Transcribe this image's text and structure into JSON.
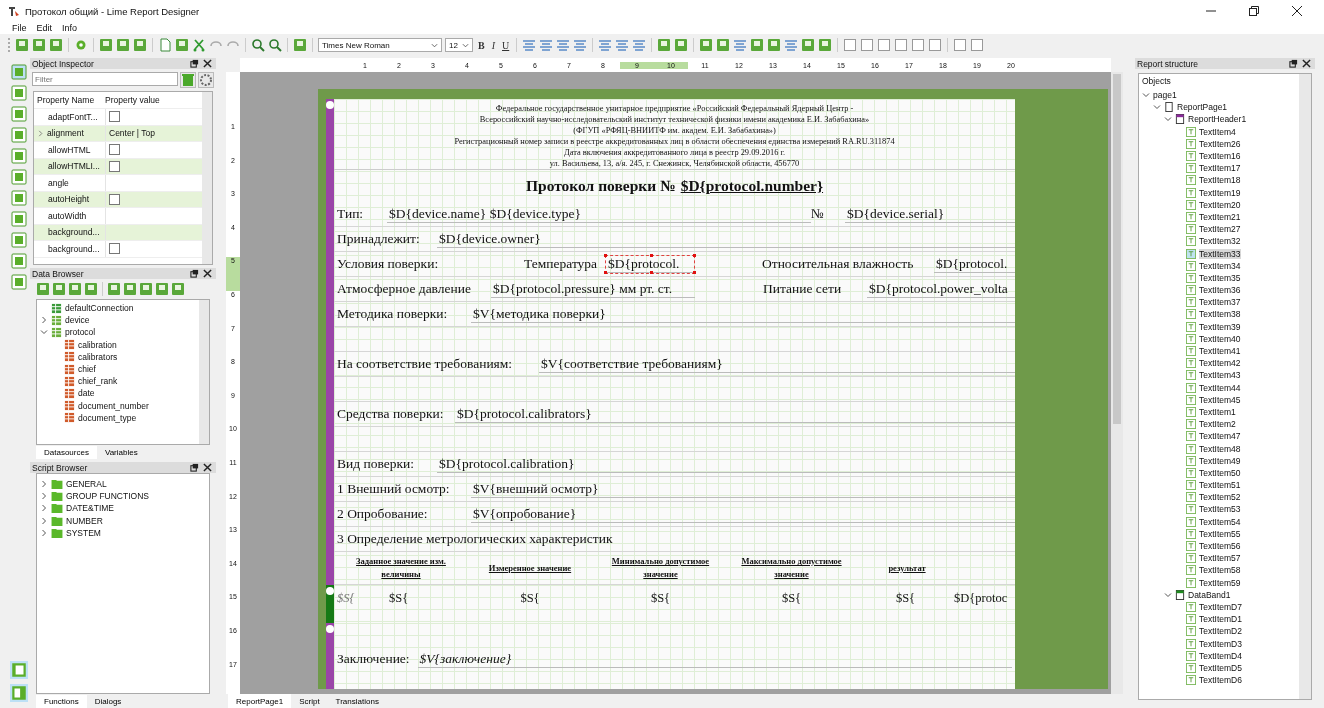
{
  "window": {
    "title": "Протокол общий - Lime Report Designer"
  },
  "menu": [
    "File",
    "Edit",
    "Info"
  ],
  "toolbar": {
    "font": "Times New Roman",
    "size": "12",
    "format": [
      {
        "label": "B",
        "kind": "bold"
      },
      {
        "label": "I",
        "kind": "italic"
      },
      {
        "label": "U",
        "kind": "underline"
      }
    ]
  },
  "object_inspector": {
    "title": "Object Inspector",
    "filter_placeholder": "Filter",
    "columns": [
      "Property Name",
      "Property value"
    ],
    "rows": [
      {
        "name": "adaptFontT...",
        "kind": "checkbox",
        "checked": false,
        "expandable": false
      },
      {
        "name": "alignment",
        "kind": "text",
        "value": "Center | Top",
        "expandable": true
      },
      {
        "name": "allowHTML",
        "kind": "checkbox",
        "checked": false,
        "expandable": false
      },
      {
        "name": "allowHTMLI...",
        "kind": "checkbox",
        "checked": false,
        "expandable": false
      },
      {
        "name": "angle",
        "kind": "text",
        "expandable": false
      },
      {
        "name": "autoHeight",
        "kind": "checkbox",
        "checked": false,
        "expandable": false
      },
      {
        "name": "autoWidth",
        "kind": "text",
        "expandable": false
      },
      {
        "name": "background...",
        "kind": "text",
        "expandable": false
      },
      {
        "name": "background...",
        "kind": "checkbox",
        "checked": false,
        "expandable": false
      }
    ]
  },
  "data_browser": {
    "title": "Data Browser",
    "tree": [
      {
        "label": "defaultConnection",
        "kind": "connection"
      },
      {
        "label": "device",
        "kind": "table",
        "expanded": false
      },
      {
        "label": "protocol",
        "kind": "table",
        "expanded": true,
        "children": [
          {
            "label": "calibration",
            "kind": "field"
          },
          {
            "label": "calibrators",
            "kind": "field"
          },
          {
            "label": "chief",
            "kind": "field"
          },
          {
            "label": "chief_rank",
            "kind": "field"
          },
          {
            "label": "date",
            "kind": "field"
          },
          {
            "label": "document_number",
            "kind": "field"
          },
          {
            "label": "document_type",
            "kind": "field"
          }
        ]
      }
    ],
    "tabs": [
      {
        "label": "Datasources",
        "selected": true
      },
      {
        "label": "Variables",
        "selected": false
      }
    ]
  },
  "script_browser": {
    "title": "Script Browser",
    "items": [
      "GENERAL",
      "GROUP FUNCTIONS",
      "DATE&TIME",
      "NUMBER",
      "SYSTEM"
    ],
    "tabs": [
      {
        "label": "Functions",
        "selected": true
      },
      {
        "label": "Dialogs",
        "selected": false
      }
    ]
  },
  "rulers": {
    "horizontal": [
      {
        "label": "1",
        "highlighted": false
      },
      {
        "label": "2",
        "highlighted": false
      },
      {
        "label": "3",
        "highlighted": false
      },
      {
        "label": "4",
        "highlighted": false
      },
      {
        "label": "5",
        "highlighted": false
      },
      {
        "label": "6",
        "highlighted": false
      },
      {
        "label": "7",
        "highlighted": false
      },
      {
        "label": "8",
        "highlighted": false
      },
      {
        "label": "9",
        "highlighted": true
      },
      {
        "label": "10",
        "highlighted": true
      },
      {
        "label": "11",
        "highlighted": false
      },
      {
        "label": "12",
        "highlighted": false
      },
      {
        "label": "13",
        "highlighted": false
      },
      {
        "label": "14",
        "highlighted": false
      },
      {
        "label": "15",
        "highlighted": false
      },
      {
        "label": "16",
        "highlighted": false
      },
      {
        "label": "17",
        "highlighted": false
      },
      {
        "label": "18",
        "highlighted": false
      },
      {
        "label": "19",
        "highlighted": false
      },
      {
        "label": "20",
        "highlighted": false
      }
    ],
    "vertical": [
      {
        "label": "1",
        "highlighted": false
      },
      {
        "label": "2",
        "highlighted": false
      },
      {
        "label": "3",
        "highlighted": false
      },
      {
        "label": "4",
        "highlighted": false
      },
      {
        "label": "5",
        "highlighted": true
      },
      {
        "label": "6",
        "highlighted": false
      },
      {
        "label": "7",
        "highlighted": false
      },
      {
        "label": "8",
        "highlighted": false
      },
      {
        "label": "9",
        "highlighted": false
      },
      {
        "label": "10",
        "highlighted": false
      },
      {
        "label": "11",
        "highlighted": false
      },
      {
        "label": "12",
        "highlighted": false
      },
      {
        "label": "13",
        "highlighted": false
      },
      {
        "label": "14",
        "highlighted": false
      },
      {
        "label": "15",
        "highlighted": false
      },
      {
        "label": "16",
        "highlighted": false
      },
      {
        "label": "17",
        "highlighted": false
      }
    ]
  },
  "report": {
    "org_lines": [
      "Федеральное государственное унитарное предприятие «Российский Федеральный Ядерный Центр -",
      "Всероссийский научно-исследовательский институт технической физики имени академика Е.И. Забабахина»",
      "(ФГУП «РФЯЦ-ВНИИТФ им. академ. Е.И. Забабахина»)",
      "Регистрационный номер записи в реестре аккредитованных лиц в области обеспечения единства измерений RA.RU.311874",
      "Дата включения аккредитованного лица в реестр 29.09.2016 г.",
      "ул. Васильева, 13, а/я. 245, г. Снежинск, Челябинской области, 456770"
    ],
    "title": "Протокол поверки №",
    "title_field": "$D{protocol.number}",
    "rows": [
      {
        "kind": "fields",
        "cells": [
          {
            "text": "Тип:",
            "kind": "label"
          },
          {
            "text": "$D{device.name} $D{device.type}",
            "kind": "field"
          },
          {
            "text": "№",
            "kind": "label"
          },
          {
            "text": "$D{device.serial}",
            "kind": "field"
          }
        ]
      },
      {
        "kind": "fields",
        "cells": [
          {
            "text": "Принадлежит:",
            "kind": "label"
          },
          {
            "text": "$D{device.owner}",
            "kind": "field"
          }
        ]
      },
      {
        "kind": "fields",
        "cells": [
          {
            "text": "Условия поверки:",
            "kind": "label"
          },
          {
            "text": "Температура",
            "kind": "label"
          },
          {
            "text": "$D{protocol.",
            "kind": "field",
            "selected": true
          },
          {
            "text": "Относительная влажность",
            "kind": "label"
          },
          {
            "text": "$D{protocol.",
            "kind": "field"
          }
        ]
      },
      {
        "kind": "fields",
        "cells": [
          {
            "text": "Атмосферное давление",
            "kind": "label"
          },
          {
            "text": "$D{protocol.pressure} мм рт. ст.",
            "kind": "field"
          },
          {
            "text": "Питание сети",
            "kind": "label"
          },
          {
            "text": "$D{protocol.power_volta",
            "kind": "field"
          }
        ]
      },
      {
        "kind": "fields",
        "cells": [
          {
            "text": "Методика поверки:",
            "kind": "label"
          },
          {
            "text": "$V{методика поверки}",
            "kind": "field"
          }
        ]
      },
      {
        "kind": "blank"
      },
      {
        "kind": "fields",
        "cells": [
          {
            "text": "На соответствие требованиям:",
            "kind": "label"
          },
          {
            "text": "$V{соответствие требованиям}",
            "kind": "field"
          }
        ]
      },
      {
        "kind": "blank"
      },
      {
        "kind": "fields",
        "cells": [
          {
            "text": "Средства поверки:",
            "kind": "label"
          },
          {
            "text": "$D{protocol.calibrators}",
            "kind": "field"
          }
        ]
      },
      {
        "kind": "blank"
      },
      {
        "kind": "fields",
        "cells": [
          {
            "text": "Вид поверки:",
            "kind": "label"
          },
          {
            "text": "$D{protocol.calibration}",
            "kind": "field"
          }
        ]
      },
      {
        "kind": "fields",
        "cells": [
          {
            "text": "1 Внешний осмотр:",
            "kind": "label"
          },
          {
            "text": "$V{внешний осмотр}",
            "kind": "field"
          }
        ]
      },
      {
        "kind": "fields",
        "cells": [
          {
            "text": "2 Опробование:",
            "kind": "label"
          },
          {
            "text": "$V{опробование}",
            "kind": "field"
          }
        ]
      },
      {
        "kind": "fields",
        "cells": [
          {
            "text": "3 Определение метрологических характеристик",
            "kind": "label"
          }
        ]
      },
      {
        "kind": "table-header",
        "cells": [
          {
            "text": "Заданное значение изм. величины",
            "kind": "head"
          },
          {
            "text": "Измеренное значение",
            "kind": "head"
          },
          {
            "text": "Минимально допустимое значение",
            "kind": "head"
          },
          {
            "text": "Максимально допустимое значение",
            "kind": "head"
          },
          {
            "text": "результат",
            "kind": "head"
          }
        ]
      }
    ],
    "data_row": [
      {
        "text": "$S{",
        "kind": "italic"
      },
      {
        "text": "$S{",
        "kind": "field"
      },
      {
        "text": "$S{",
        "kind": "field"
      },
      {
        "text": "$S{",
        "kind": "field"
      },
      {
        "text": "$S{",
        "kind": "field"
      },
      {
        "text": "$S{",
        "kind": "field"
      },
      {
        "text": "$D{protoc",
        "kind": "field"
      }
    ],
    "footer": [
      {
        "text": "Заключение:",
        "kind": "label"
      },
      {
        "text": "$V{заключение}",
        "kind": "italic"
      }
    ]
  },
  "bottom_tabs": [
    {
      "label": "ReportPage1",
      "selected": true
    },
    {
      "label": "Script",
      "selected": false
    },
    {
      "label": "Translations",
      "selected": false
    }
  ],
  "report_structure": {
    "title": "Report structure",
    "header": "Objects",
    "tree": [
      {
        "label": "page1",
        "selected": false,
        "expanded": true,
        "children": [
          {
            "label": "ReportPage1",
            "kind": "report-page",
            "selected": false,
            "expanded": true,
            "children": [
              {
                "label": "ReportHeader1",
                "kind": "header-band",
                "selected": false,
                "expanded": true,
                "children": [
                  {
                    "label": "TextItem4",
                    "kind": "text",
                    "selected": false
                  },
                  {
                    "label": "TextItem26",
                    "kind": "text",
                    "selected": false
                  },
                  {
                    "label": "TextItem16",
                    "kind": "text",
                    "selected": false
                  },
                  {
                    "label": "TextItem17",
                    "kind": "text",
                    "selected": false
                  },
                  {
                    "label": "TextItem18",
                    "kind": "text",
                    "selected": false
                  },
                  {
                    "label": "TextItem19",
                    "kind": "text",
                    "selected": false
                  },
                  {
                    "label": "TextItem20",
                    "kind": "text",
                    "selected": false
                  },
                  {
                    "label": "TextItem21",
                    "kind": "text",
                    "selected": false
                  },
                  {
                    "label": "TextItem27",
                    "kind": "text",
                    "selected": false
                  },
                  {
                    "label": "TextItem32",
                    "kind": "text",
                    "selected": false
                  },
                  {
                    "label": "TextItem33",
                    "kind": "text",
                    "selected": true
                  },
                  {
                    "label": "TextItem34",
                    "kind": "text",
                    "selected": false
                  },
                  {
                    "label": "TextItem35",
                    "kind": "text",
                    "selected": false
                  },
                  {
                    "label": "TextItem36",
                    "kind": "text",
                    "selected": false
                  },
                  {
                    "label": "TextItem37",
                    "kind": "text",
                    "selected": false
                  },
                  {
                    "label": "TextItem38",
                    "kind": "text",
                    "selected": false
                  },
                  {
                    "label": "TextItem39",
                    "kind": "text",
                    "selected": false
                  },
                  {
                    "label": "TextItem40",
                    "kind": "text",
                    "selected": false
                  },
                  {
                    "label": "TextItem41",
                    "kind": "text",
                    "selected": false
                  },
                  {
                    "label": "TextItem42",
                    "kind": "text",
                    "selected": false
                  },
                  {
                    "label": "TextItem43",
                    "kind": "text",
                    "selected": false
                  },
                  {
                    "label": "TextItem44",
                    "kind": "text",
                    "selected": false
                  },
                  {
                    "label": "TextItem45",
                    "kind": "text",
                    "selected": false
                  },
                  {
                    "label": "TextItem1",
                    "kind": "text",
                    "selected": false
                  },
                  {
                    "label": "TextItem2",
                    "kind": "text",
                    "selected": false
                  },
                  {
                    "label": "TextItem47",
                    "kind": "text",
                    "selected": false
                  },
                  {
                    "label": "TextItem48",
                    "kind": "text",
                    "selected": false
                  },
                  {
                    "label": "TextItem49",
                    "kind": "text",
                    "selected": false
                  },
                  {
                    "label": "TextItem50",
                    "kind": "text",
                    "selected": false
                  },
                  {
                    "label": "TextItem51",
                    "kind": "text",
                    "selected": false
                  },
                  {
                    "label": "TextItem52",
                    "kind": "text",
                    "selected": false
                  },
                  {
                    "label": "TextItem53",
                    "kind": "text",
                    "selected": false
                  },
                  {
                    "label": "TextItem54",
                    "kind": "text",
                    "selected": false
                  },
                  {
                    "label": "TextItem55",
                    "kind": "text",
                    "selected": false
                  },
                  {
                    "label": "TextItem56",
                    "kind": "text",
                    "selected": false
                  },
                  {
                    "label": "TextItem57",
                    "kind": "text",
                    "selected": false
                  },
                  {
                    "label": "TextItem58",
                    "kind": "text",
                    "selected": false
                  },
                  {
                    "label": "TextItem59",
                    "kind": "text",
                    "selected": false
                  }
                ]
              },
              {
                "label": "DataBand1",
                "kind": "data-band",
                "selected": false,
                "expanded": true,
                "children": [
                  {
                    "label": "TextItemD7",
                    "kind": "text",
                    "selected": false
                  },
                  {
                    "label": "TextItemD1",
                    "kind": "text",
                    "selected": false
                  },
                  {
                    "label": "TextItemD2",
                    "kind": "text",
                    "selected": false
                  },
                  {
                    "label": "TextItemD3",
                    "kind": "text",
                    "selected": false
                  },
                  {
                    "label": "TextItemD4",
                    "kind": "text",
                    "selected": false
                  },
                  {
                    "label": "TextItemD5",
                    "kind": "text",
                    "selected": false
                  },
                  {
                    "label": "TextItemD6",
                    "kind": "text",
                    "selected": false
                  }
                ]
              }
            ]
          }
        ]
      }
    ]
  }
}
